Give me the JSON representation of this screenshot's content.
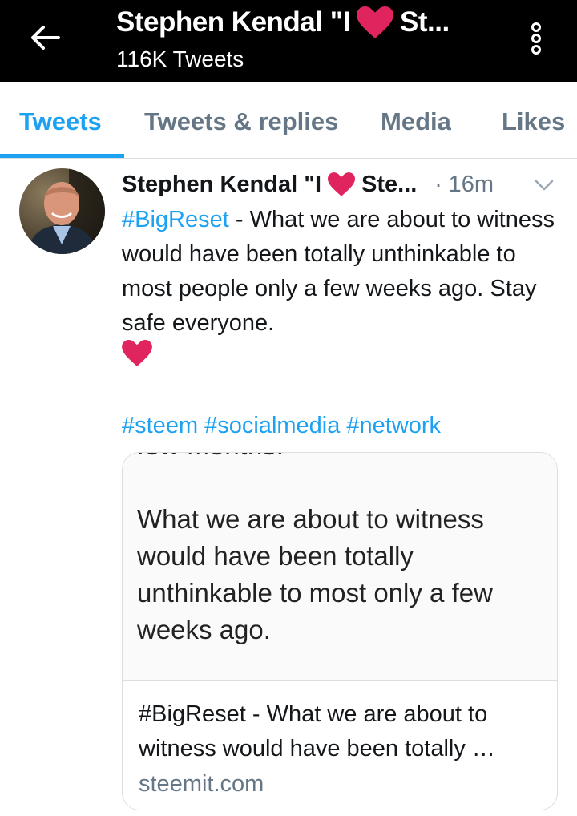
{
  "header": {
    "title_prefix": "Stephen Kendal \"I",
    "title_suffix": "St...",
    "tweet_count": "116K Tweets",
    "back_icon": "arrow-left-icon",
    "more_icon": "more-vertical-icon"
  },
  "tabs": [
    {
      "label": "Tweets",
      "active": true
    },
    {
      "label": "Tweets & replies",
      "active": false
    },
    {
      "label": "Media",
      "active": false
    },
    {
      "label": "Likes",
      "active": false
    }
  ],
  "tweet": {
    "author_prefix": "Stephen Kendal \"I",
    "author_suffix": "Ste...",
    "separator": "·",
    "time": "16m",
    "hashtag_lead": "#BigReset",
    "text": " - What we are about to witness would have been totally unthinkable to most people only a few weeks ago. Stay safe everyone.",
    "tags": [
      "#steem",
      "#socialmedia",
      "#network"
    ],
    "card": {
      "cut_text": "few months.",
      "quote": "What we are about to witness would have been totally unthinkable to most only a few weeks ago.",
      "title": "#BigReset - What we are about to witness would have been totally …",
      "domain": "steemit.com"
    }
  },
  "colors": {
    "accent": "#1da1f2",
    "heart": "#e0245e",
    "header_bg": "#000000",
    "muted": "#657786"
  }
}
